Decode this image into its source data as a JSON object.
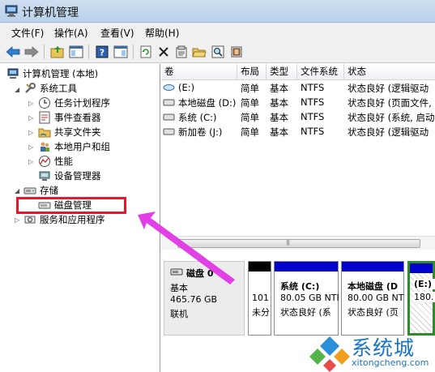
{
  "window": {
    "title": "计算机管理"
  },
  "menu": [
    "文件(F)",
    "操作(A)",
    "查看(V)",
    "帮助(H)"
  ],
  "toolbar": {
    "icons": [
      "back-arrow-icon",
      "forward-arrow-icon",
      "up-folder-icon",
      "show-hide-tree-icon",
      "help-icon",
      "view-pane-icon",
      "refresh-icon",
      "delete-icon",
      "properties-icon",
      "open-folder-icon",
      "search-icon",
      "export-icon"
    ]
  },
  "tree": {
    "root": "计算机管理 (本地)",
    "system_tools": "系统工具",
    "task_scheduler": "任务计划程序",
    "event_viewer": "事件查看器",
    "shared_folders": "共享文件夹",
    "local_users": "本地用户和组",
    "performance": "性能",
    "device_manager": "设备管理器",
    "storage": "存储",
    "disk_management": "磁盘管理",
    "services_apps": "服务和应用程序"
  },
  "volume_table": {
    "headers": [
      "卷",
      "布局",
      "类型",
      "文件系统",
      "状态"
    ],
    "rows": [
      [
        "(E:)",
        "简单",
        "基本",
        "NTFS",
        "状态良好 (逻辑驱动"
      ],
      [
        "本地磁盘 (D:)",
        "简单",
        "基本",
        "NTFS",
        "状态良好 (页面文件,"
      ],
      [
        "系统 (C:)",
        "简单",
        "基本",
        "NTFS",
        "状态良好 (系统, 启动"
      ],
      [
        "新加卷 (J:)",
        "简单",
        "基本",
        "NTFS",
        "状态良好 (逻辑驱动"
      ]
    ]
  },
  "disk": {
    "name": "磁盘 0",
    "type": "基本",
    "size": "465.76 GB",
    "status": "联机",
    "partitions": [
      {
        "line1": "101",
        "line2": "未分",
        "line3": "",
        "bar_color": "#000000"
      },
      {
        "line1": "系统 (C:)",
        "line2": "80.05 GB NTF",
        "line3": "状态良好 (系",
        "bar_color": "#0000cc"
      },
      {
        "line1": "本地磁盘 (D",
        "line2": "80.00 GB NTF",
        "line3": "状态良好 (页",
        "bar_color": "#0000cc"
      },
      {
        "line1": "(E:)",
        "line2": "180.",
        "line3": "",
        "bar_color": "#0000cc"
      }
    ]
  },
  "watermark": {
    "text": "系统城",
    "url": "xitongcheng.com"
  },
  "colors": {
    "highlight": "#e3192b",
    "arrow": "#e040e6",
    "partition_bar": "#0000cc"
  }
}
